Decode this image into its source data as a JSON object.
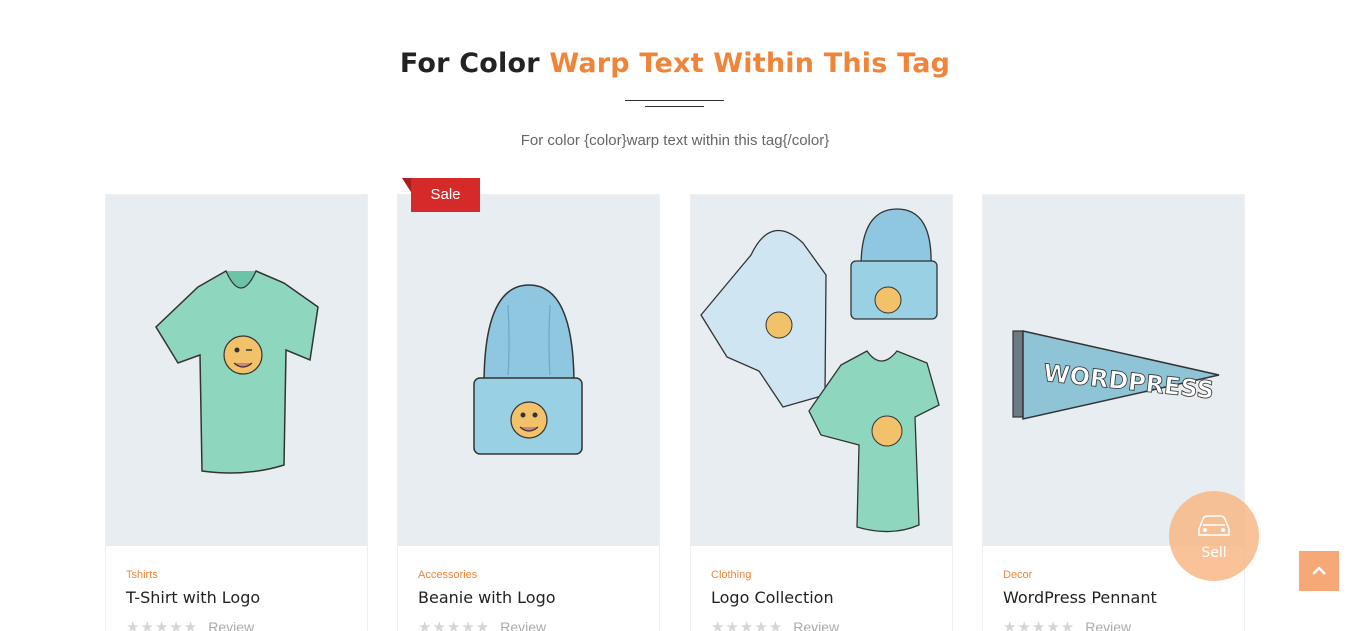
{
  "section": {
    "heading_plain": "For Color",
    "heading_accent": "Warp Text Within This Tag",
    "subtitle": "For color {color}warp text within this tag{/color}"
  },
  "products": [
    {
      "category": "Tshirts",
      "name": "T-Shirt with Logo",
      "review_label": "Review",
      "image_icon": "tshirt-illustration"
    },
    {
      "category": "Accessories",
      "name": "Beanie with Logo",
      "review_label": "Review",
      "image_icon": "beanie-illustration",
      "badge": "Sale"
    },
    {
      "category": "Clothing",
      "name": "Logo Collection",
      "review_label": "Review",
      "image_icon": "clothing-collection-illustration"
    },
    {
      "category": "Decor",
      "name": "WordPress Pennant",
      "review_label": "Review",
      "image_icon": "pennant-illustration",
      "pennant_text": "WORDPRESS"
    }
  ],
  "fab": {
    "label": "Sell",
    "icon": "car-icon"
  },
  "scroll_top": {
    "icon": "chevron-up-icon"
  },
  "colors": {
    "accent": "#f0853a",
    "sale": "#d42a2a",
    "thumb_bg": "#e7edf1"
  }
}
